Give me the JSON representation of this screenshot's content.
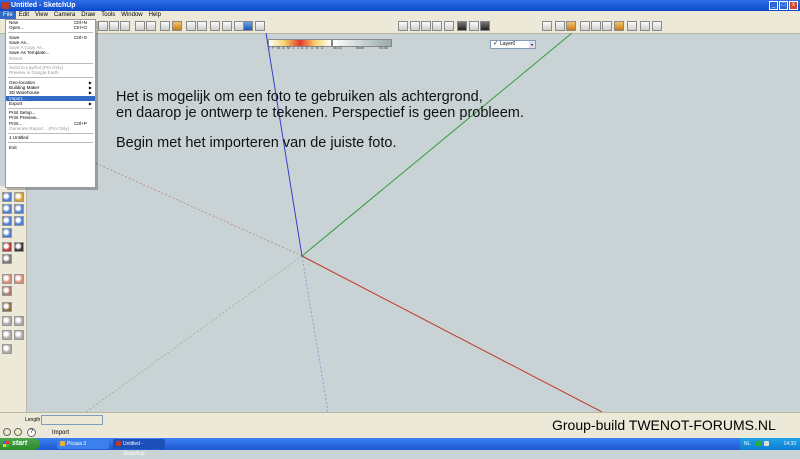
{
  "window": {
    "title": "Untitled - SketchUp",
    "minimize_glyph": "_",
    "maximize_glyph": "□",
    "close_glyph": "x"
  },
  "menubar": {
    "items": [
      "File",
      "Edit",
      "View",
      "Camera",
      "Draw",
      "Tools",
      "Window",
      "Help"
    ],
    "active_index": 0
  },
  "toolbar": {
    "shadow_months": "J F M A M J J A S O N D",
    "shadow_time_start": "06:43",
    "shadow_time_noon": "Noon",
    "shadow_time_end": "04:46",
    "layer_check": "✓",
    "layer_name": "Layer0",
    "layer_dropdown_glyph": "▾"
  },
  "file_menu": {
    "groups": [
      [
        {
          "label": "New",
          "shortcut": "Ctrl+N",
          "disabled": false
        },
        {
          "label": "Open...",
          "shortcut": "Ctrl+O",
          "disabled": false
        }
      ],
      [
        {
          "label": "Save",
          "shortcut": "Ctrl+S",
          "disabled": false
        },
        {
          "label": "Save As...",
          "shortcut": "",
          "disabled": false
        },
        {
          "label": "Save A Copy As...",
          "shortcut": "",
          "disabled": true
        },
        {
          "label": "Save As Template...",
          "shortcut": "",
          "disabled": false
        },
        {
          "label": "Revert",
          "shortcut": "",
          "disabled": true
        }
      ],
      [
        {
          "label": "Send to LayOut (Pro Only)",
          "shortcut": "",
          "disabled": true
        },
        {
          "label": "Preview in Google Earth",
          "shortcut": "",
          "disabled": true
        }
      ],
      [
        {
          "label": "Geo-location",
          "shortcut": "",
          "disabled": false,
          "submenu": true
        },
        {
          "label": "Building Maker",
          "shortcut": "",
          "disabled": false,
          "submenu": true
        },
        {
          "label": "3D Warehouse",
          "shortcut": "",
          "disabled": false,
          "submenu": true
        },
        {
          "label": "Import...",
          "shortcut": "",
          "disabled": false,
          "highlighted": true
        },
        {
          "label": "Export",
          "shortcut": "",
          "disabled": false,
          "submenu": true
        }
      ],
      [
        {
          "label": "Print Setup...",
          "shortcut": "",
          "disabled": false
        },
        {
          "label": "Print Preview...",
          "shortcut": "",
          "disabled": false
        },
        {
          "label": "Print...",
          "shortcut": "Ctrl+P",
          "disabled": false
        },
        {
          "label": "Generate Report... (Pro Only)",
          "shortcut": "",
          "disabled": true
        }
      ],
      [
        {
          "label": "1 Untitled",
          "shortcut": "",
          "disabled": false
        }
      ],
      [
        {
          "label": "Exit",
          "shortcut": "",
          "disabled": false
        }
      ]
    ],
    "submenu_arrow": "▶"
  },
  "overlay_text": {
    "line1": "Het is mogelijk om een foto te gebruiken als achtergrond,",
    "line2": "en daarop je ontwerp te tekenen. Perspectief is geen probleem.",
    "line3": "Begin met het importeren van de juiste foto."
  },
  "statusbar": {
    "length_label": "Length",
    "length_value": "",
    "status_text": "Import",
    "help_glyph": "?"
  },
  "watermark": "Group-build TWENOT-FORUMS.NL",
  "taskbar": {
    "start_label": "start",
    "tasks": [
      {
        "label": "Picasa 3"
      },
      {
        "label": "Untitled - SketchUp"
      }
    ],
    "language": "NL",
    "clock": "14:33"
  },
  "colors": {
    "canvas": "#c9d3d6",
    "axis_red": "#c0392b",
    "axis_green": "#2f9d3a",
    "axis_blue": "#3440c8",
    "menu_highlight": "#316ac5",
    "titlebar": "#0a48c9"
  }
}
